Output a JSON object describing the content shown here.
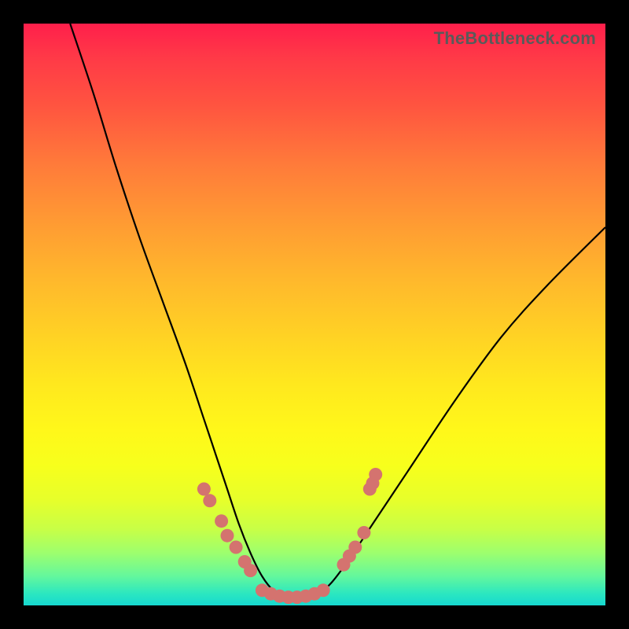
{
  "watermark": "TheBottleneck.com",
  "colors": {
    "frame_bg": "#000000",
    "curve_stroke": "#000000",
    "dot_fill": "#d4736f",
    "gradient_top": "#ff1f4b",
    "gradient_bottom": "#16d8d0"
  },
  "chart_data": {
    "type": "line",
    "title": "",
    "xlabel": "",
    "ylabel": "",
    "xlim": [
      0,
      100
    ],
    "ylim": [
      0,
      100
    ],
    "grid": false,
    "legend": false,
    "note": "Approximate V-shaped bottleneck curve. No axis ticks visible; values estimated on 0–100 scale. y=0 is optimal (bottom/green), y=100 is worst (top/red). Minimum plateau near x≈42–50.",
    "series": [
      {
        "name": "bottleneck_curve",
        "x": [
          8,
          12,
          16,
          20,
          24,
          28,
          31,
          33,
          35,
          37,
          39,
          41,
          43,
          45,
          47,
          49,
          51,
          53,
          56,
          60,
          66,
          74,
          82,
          90,
          100
        ],
        "y": [
          100,
          88,
          75,
          63,
          52,
          41,
          32,
          26,
          20,
          14,
          9,
          5,
          2.5,
          1.5,
          1.3,
          1.5,
          2.3,
          4,
          8,
          14,
          23,
          35,
          46,
          55,
          65
        ]
      }
    ],
    "markers": [
      {
        "name": "left_cluster",
        "points": [
          {
            "x": 31,
            "y": 20
          },
          {
            "x": 32,
            "y": 18
          },
          {
            "x": 34,
            "y": 14.5
          },
          {
            "x": 35,
            "y": 12
          },
          {
            "x": 36.5,
            "y": 10
          },
          {
            "x": 38,
            "y": 7.5
          },
          {
            "x": 39,
            "y": 6
          }
        ]
      },
      {
        "name": "bottom_plateau",
        "points": [
          {
            "x": 41,
            "y": 2.6
          },
          {
            "x": 42.5,
            "y": 2.0
          },
          {
            "x": 44,
            "y": 1.6
          },
          {
            "x": 45.5,
            "y": 1.4
          },
          {
            "x": 47,
            "y": 1.4
          },
          {
            "x": 48.5,
            "y": 1.6
          },
          {
            "x": 50,
            "y": 2.0
          },
          {
            "x": 51.5,
            "y": 2.6
          }
        ]
      },
      {
        "name": "right_cluster",
        "points": [
          {
            "x": 55,
            "y": 7
          },
          {
            "x": 56,
            "y": 8.5
          },
          {
            "x": 57,
            "y": 10
          },
          {
            "x": 58.5,
            "y": 12.5
          },
          {
            "x": 59.5,
            "y": 20
          },
          {
            "x": 60,
            "y": 21
          },
          {
            "x": 60.5,
            "y": 22.5
          }
        ]
      }
    ]
  }
}
